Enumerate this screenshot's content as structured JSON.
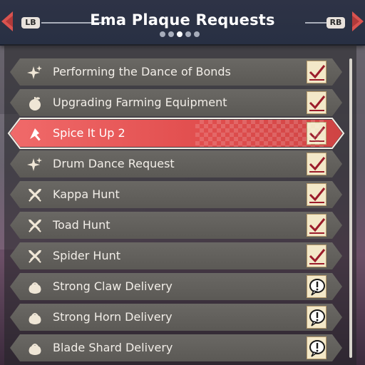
{
  "header": {
    "title": "Ema Plaque Requests",
    "left_button": "LB",
    "right_button": "RB",
    "pages_total": 5,
    "pages_active_index": 2
  },
  "requests": [
    {
      "label": "Performing the Dance of Bonds",
      "icon": "sparkle-icon",
      "status": "completed",
      "selected": false
    },
    {
      "label": "Upgrading Farming Equipment",
      "icon": "apple-icon",
      "status": "completed",
      "selected": false
    },
    {
      "label": "Spice It Up 2",
      "icon": "cleaver-icon",
      "status": "completed",
      "selected": true
    },
    {
      "label": "Drum Dance Request",
      "icon": "sparkle-icon",
      "status": "completed",
      "selected": false
    },
    {
      "label": "Kappa Hunt",
      "icon": "crossed-swords-icon",
      "status": "completed",
      "selected": false
    },
    {
      "label": "Toad Hunt",
      "icon": "crossed-swords-icon",
      "status": "completed",
      "selected": false
    },
    {
      "label": "Spider Hunt",
      "icon": "crossed-swords-icon",
      "status": "completed",
      "selected": false
    },
    {
      "label": "Strong Claw Delivery",
      "icon": "pouch-icon",
      "status": "new",
      "selected": false
    },
    {
      "label": "Strong Horn Delivery",
      "icon": "pouch-icon",
      "status": "new",
      "selected": false
    },
    {
      "label": "Blade Shard Delivery",
      "icon": "pouch-icon",
      "status": "new",
      "selected": false
    }
  ],
  "colors": {
    "selected_row": "#e24f4f",
    "row": "#62605c",
    "checkmark": "#9b1c2a",
    "header": "#2b3244"
  }
}
